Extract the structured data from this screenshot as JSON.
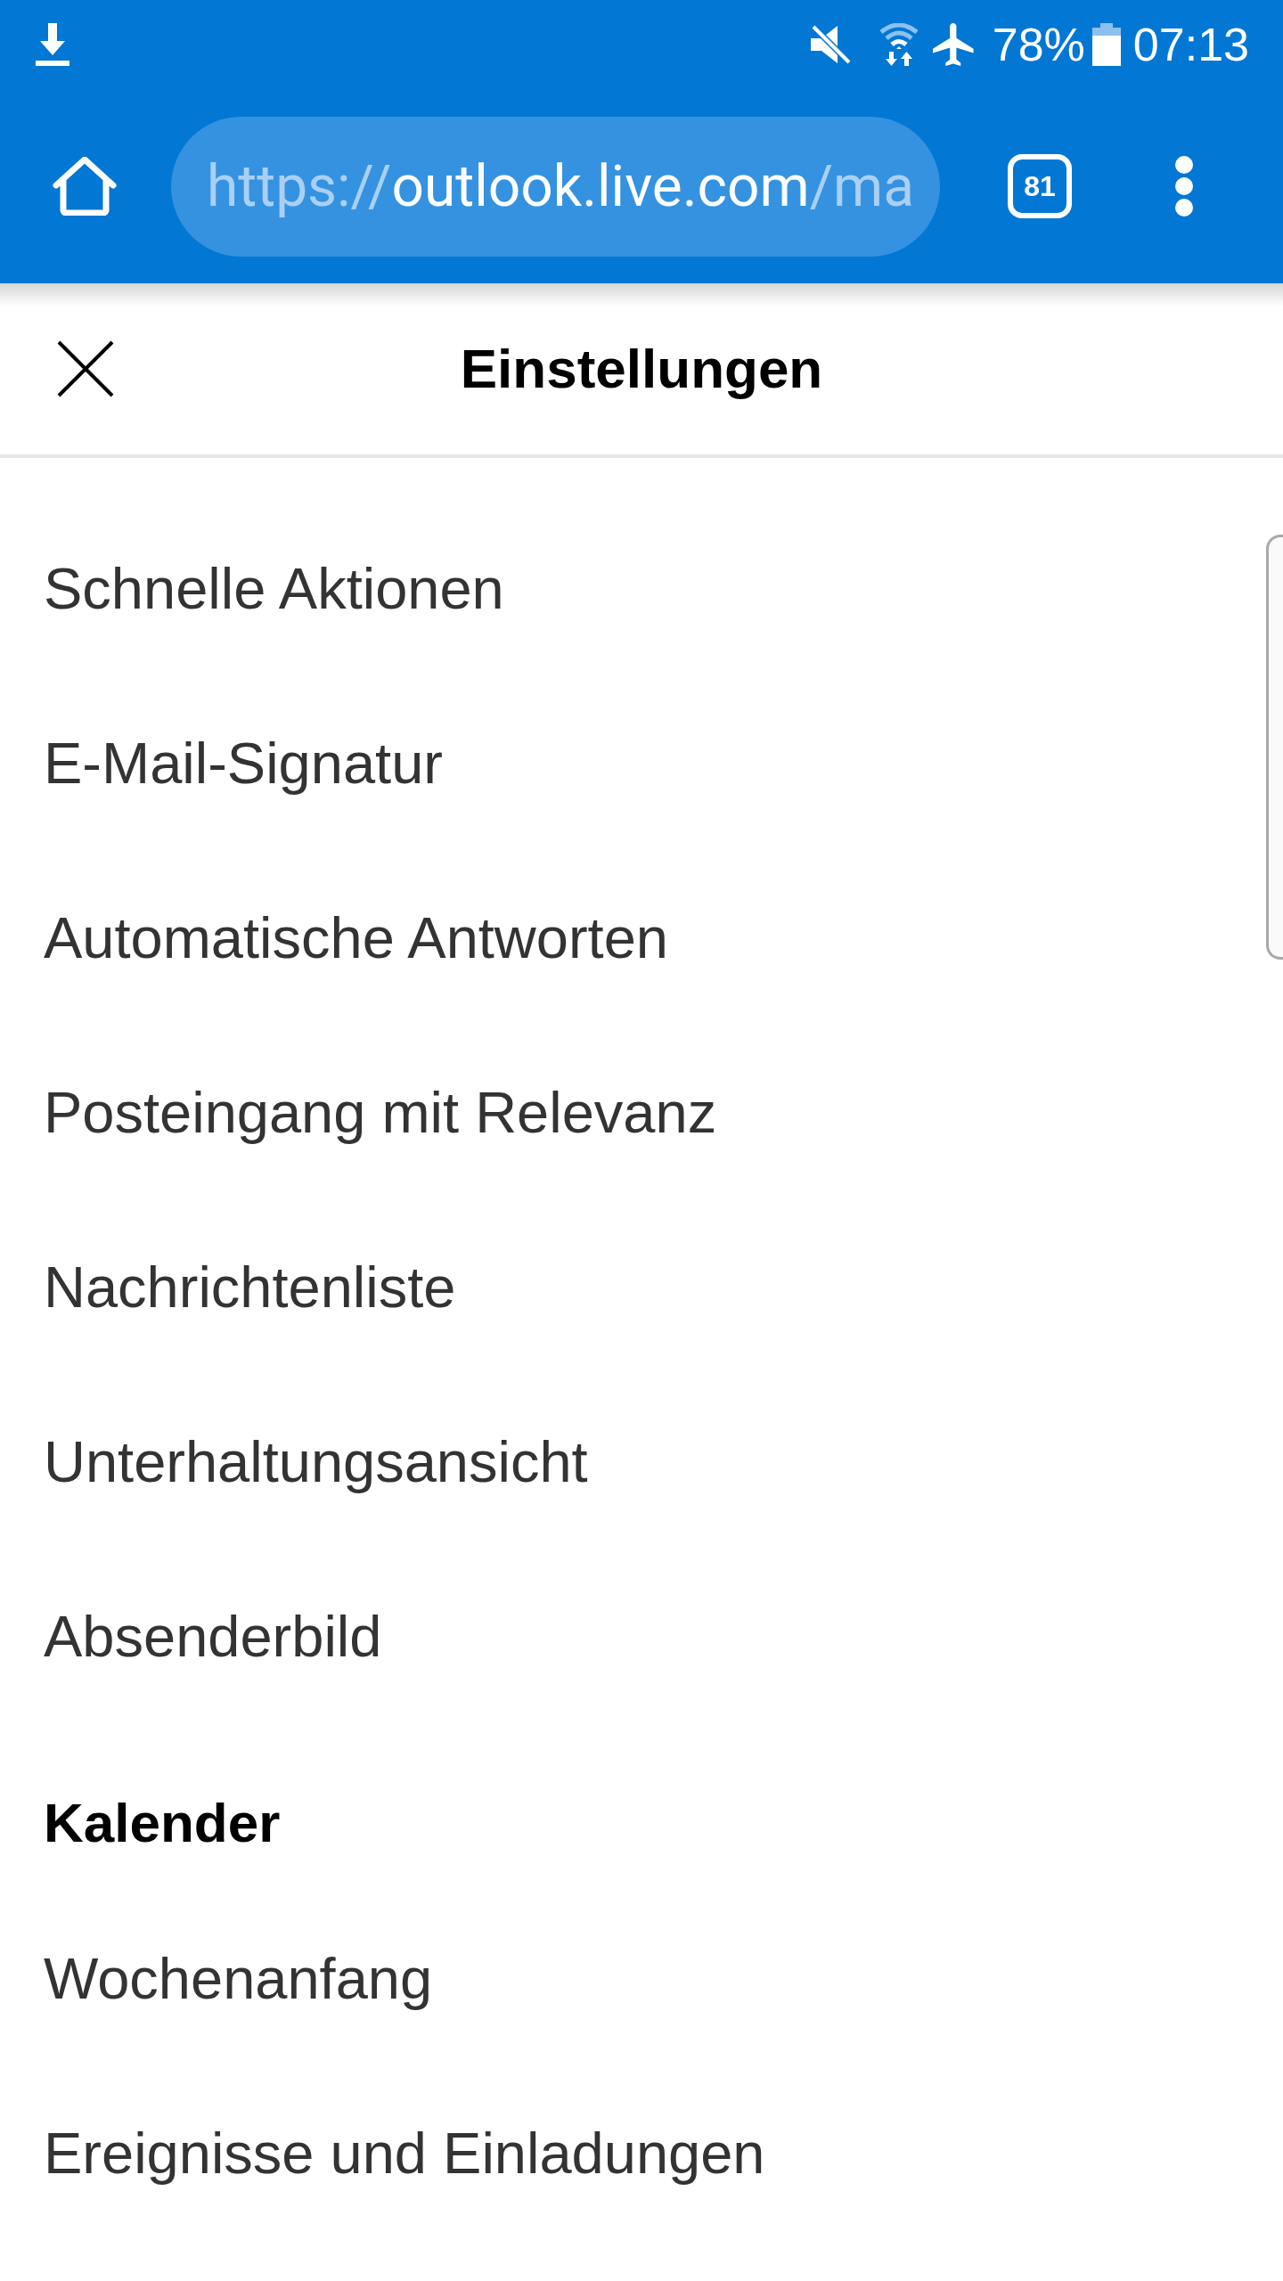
{
  "status_bar": {
    "battery_percent": "78%",
    "time": "07:13"
  },
  "browser_toolbar": {
    "url": {
      "scheme": "https://",
      "host": "outlook.live.com",
      "path": "/ma"
    },
    "tab_count": "81"
  },
  "header": {
    "title": "Einstellungen"
  },
  "settings": [
    {
      "kind": "item",
      "label": "Schnelle Aktionen"
    },
    {
      "kind": "item",
      "label": "E-Mail-Signatur"
    },
    {
      "kind": "item",
      "label": "Automatische Antworten"
    },
    {
      "kind": "item",
      "label": "Posteingang mit Relevanz"
    },
    {
      "kind": "item",
      "label": "Nachrichtenliste"
    },
    {
      "kind": "item",
      "label": "Unterhaltungsansicht"
    },
    {
      "kind": "item",
      "label": "Absenderbild"
    },
    {
      "kind": "section",
      "label": "Kalender"
    },
    {
      "kind": "item",
      "label": "Wochenanfang"
    },
    {
      "kind": "item",
      "label": "Ereignisse und Einladungen"
    }
  ]
}
